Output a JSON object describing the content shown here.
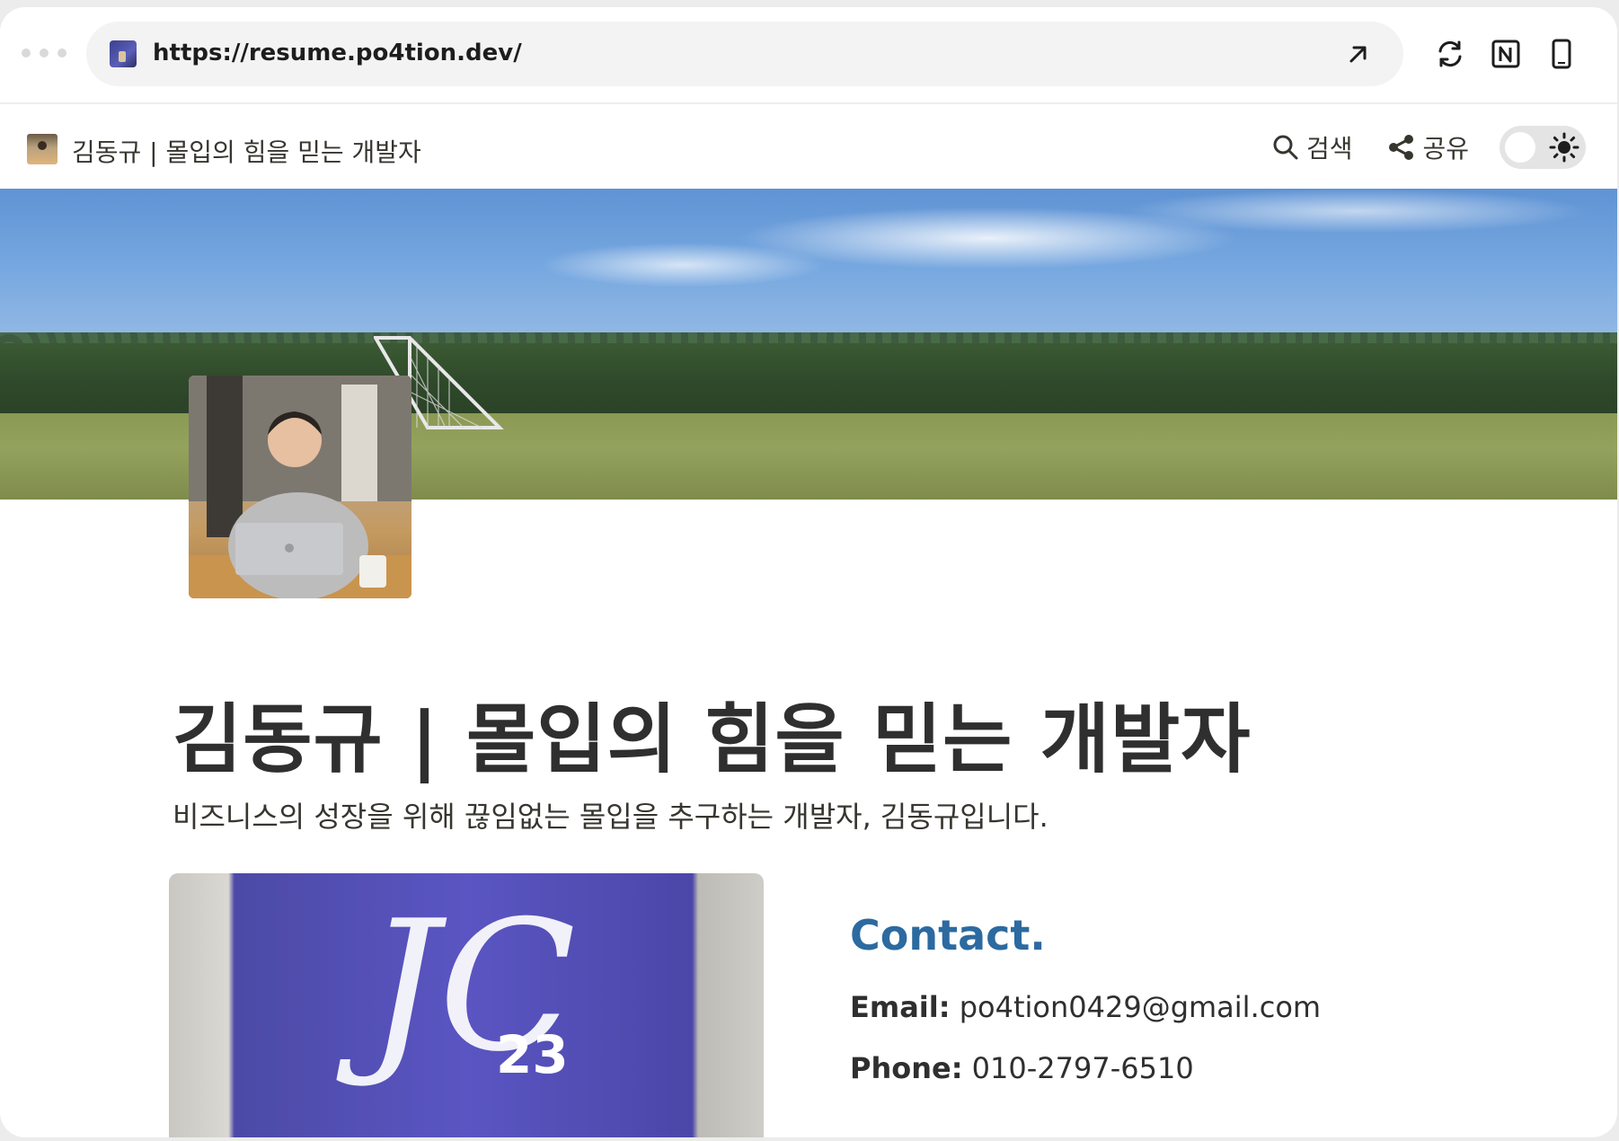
{
  "browser": {
    "url": "https://resume.po4tion.dev/"
  },
  "topbar": {
    "breadcrumb": "김동규 | 몰입의 힘을 믿는 개발자",
    "search_label": "검색",
    "share_label": "공유"
  },
  "page": {
    "title": "김동규 | 몰입의 힘을 믿는 개발자",
    "subtitle": "비즈니스의 성장을 위해 끊임없는 몰입을 추구하는 개발자, 김동규입니다."
  },
  "photo": {
    "badge_number": "23"
  },
  "contact": {
    "title": "Contact.",
    "email_label": "Email:",
    "email_value": "po4tion0429@gmail.com",
    "phone_label": "Phone:",
    "phone_value": "010-2797-6510"
  },
  "colors": {
    "accent": "#2c6aa0",
    "text": "#37352f"
  },
  "icons": [
    "window-dots-icon",
    "site-favicon",
    "open-external-icon",
    "refresh-icon",
    "notion-icon",
    "mobile-icon",
    "search-icon",
    "share-icon",
    "theme-toggle",
    "sun-icon"
  ]
}
